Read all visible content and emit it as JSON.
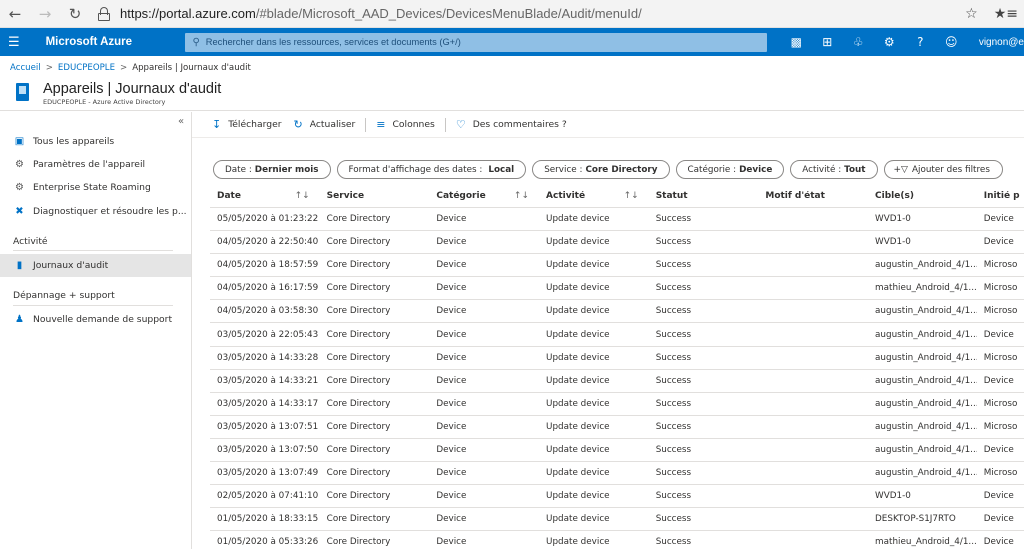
{
  "browser": {
    "url_host": "https://portal.azure.com",
    "url_path": "/#blade/Microsoft_AAD_Devices/DevicesMenuBlade/Audit/menuId/"
  },
  "azure": {
    "brand": "Microsoft Azure",
    "search_placeholder": "Rechercher dans les ressources, services et documents (G+/)",
    "user": "vignon@e"
  },
  "breadcrumb": {
    "home": "Accueil",
    "tenant": "EDUCPEOPLE",
    "current": "Appareils | Journaux d'audit"
  },
  "header": {
    "title": "Appareils | Journaux d'audit",
    "subtitle": "EDUCPEOPLE - Azure Active Directory"
  },
  "sidebar": {
    "items": [
      {
        "label": "Tous les appareils",
        "icon": "devices-icon"
      },
      {
        "label": "Paramètres de l'appareil",
        "icon": "gear-icon"
      },
      {
        "label": "Enterprise State Roaming",
        "icon": "gear-icon"
      },
      {
        "label": "Diagnostiquer et résoudre les p...",
        "icon": "wrench-icon"
      }
    ],
    "section_activity": "Activité",
    "activity_items": [
      {
        "label": "Journaux d'audit",
        "icon": "audit-log-icon"
      }
    ],
    "section_support": "Dépannage + support",
    "support_items": [
      {
        "label": "Nouvelle demande de support",
        "icon": "support-person-icon"
      }
    ]
  },
  "toolbar": {
    "download": "Télécharger",
    "refresh": "Actualiser",
    "columns": "Colonnes",
    "feedback": "Des commentaires ?"
  },
  "filters": {
    "date_label": "Date :",
    "date_value": "Dernier mois",
    "format_label": "Format d'affichage des dates :",
    "format_value": "Local",
    "service_label": "Service :",
    "service_value": "Core Directory",
    "category_label": "Catégorie :",
    "category_value": "Device",
    "activity_label": "Activité :",
    "activity_value": "Tout",
    "add_filters": "Ajouter des filtres"
  },
  "table": {
    "headers": [
      "Date",
      "Service",
      "Catégorie",
      "Activité",
      "Statut",
      "Motif d'état",
      "Cible(s)",
      "Initié p"
    ],
    "rows": [
      [
        "05/05/2020 à 01:23:22",
        "Core Directory",
        "Device",
        "Update device",
        "Success",
        "",
        "WVD1-0",
        "Device"
      ],
      [
        "04/05/2020 à 22:50:40",
        "Core Directory",
        "Device",
        "Update device",
        "Success",
        "",
        "WVD1-0",
        "Device"
      ],
      [
        "04/05/2020 à 18:57:59",
        "Core Directory",
        "Device",
        "Update device",
        "Success",
        "",
        "augustin_Android_4/1...",
        "Microso"
      ],
      [
        "04/05/2020 à 16:17:59",
        "Core Directory",
        "Device",
        "Update device",
        "Success",
        "",
        "mathieu_Android_4/1...",
        "Microso"
      ],
      [
        "04/05/2020 à 03:58:30",
        "Core Directory",
        "Device",
        "Update device",
        "Success",
        "",
        "augustin_Android_4/1...",
        "Microso"
      ],
      [
        "03/05/2020 à 22:05:43",
        "Core Directory",
        "Device",
        "Update device",
        "Success",
        "",
        "augustin_Android_4/1...",
        "Device"
      ],
      [
        "03/05/2020 à 14:33:28",
        "Core Directory",
        "Device",
        "Update device",
        "Success",
        "",
        "augustin_Android_4/1...",
        "Microso"
      ],
      [
        "03/05/2020 à 14:33:21",
        "Core Directory",
        "Device",
        "Update device",
        "Success",
        "",
        "augustin_Android_4/1...",
        "Device"
      ],
      [
        "03/05/2020 à 14:33:17",
        "Core Directory",
        "Device",
        "Update device",
        "Success",
        "",
        "augustin_Android_4/1...",
        "Microso"
      ],
      [
        "03/05/2020 à 13:07:51",
        "Core Directory",
        "Device",
        "Update device",
        "Success",
        "",
        "augustin_Android_4/1...",
        "Microso"
      ],
      [
        "03/05/2020 à 13:07:50",
        "Core Directory",
        "Device",
        "Update device",
        "Success",
        "",
        "augustin_Android_4/1...",
        "Device"
      ],
      [
        "03/05/2020 à 13:07:49",
        "Core Directory",
        "Device",
        "Update device",
        "Success",
        "",
        "augustin_Android_4/1...",
        "Microso"
      ],
      [
        "02/05/2020 à 07:41:10",
        "Core Directory",
        "Device",
        "Update device",
        "Success",
        "",
        "WVD1-0",
        "Device"
      ],
      [
        "01/05/2020 à 18:33:15",
        "Core Directory",
        "Device",
        "Update device",
        "Success",
        "",
        "DESKTOP-S1J7RTO",
        "Device"
      ],
      [
        "01/05/2020 à 05:33:26",
        "Core Directory",
        "Device",
        "Update device",
        "Success",
        "",
        "mathieu_Android_4/1...",
        "Device"
      ]
    ]
  },
  "colors": {
    "azure_blue": "#0072c6",
    "search_bg": "#8fbfe5",
    "active_item": "#e5e5e5"
  }
}
